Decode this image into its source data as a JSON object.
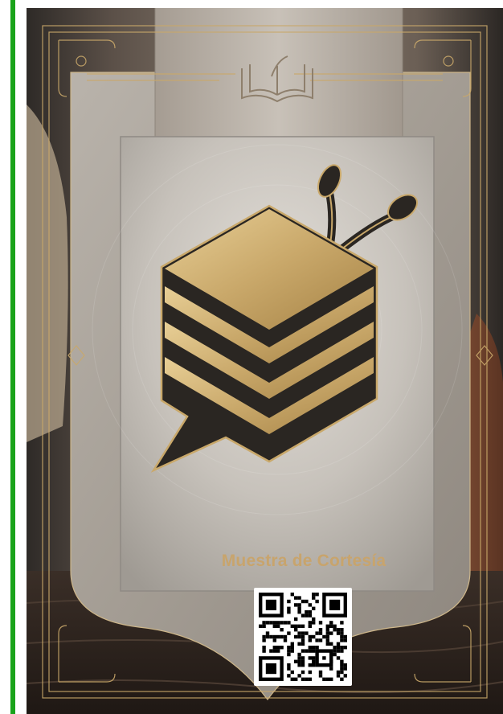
{
  "cover": {
    "courtesy_label": "Muestra de Cortesía"
  },
  "icons": {
    "open_book": "open-book-icon",
    "logo": "hexagon-speech-bubble-logo",
    "qr": "qr-code"
  },
  "colors": {
    "left_rule": "#1aa31a",
    "gold": "#c9a86a",
    "gold_text": "#c8a46c",
    "plate_silver": "#c4bfb8",
    "dark_stripe": "#2a2622"
  }
}
